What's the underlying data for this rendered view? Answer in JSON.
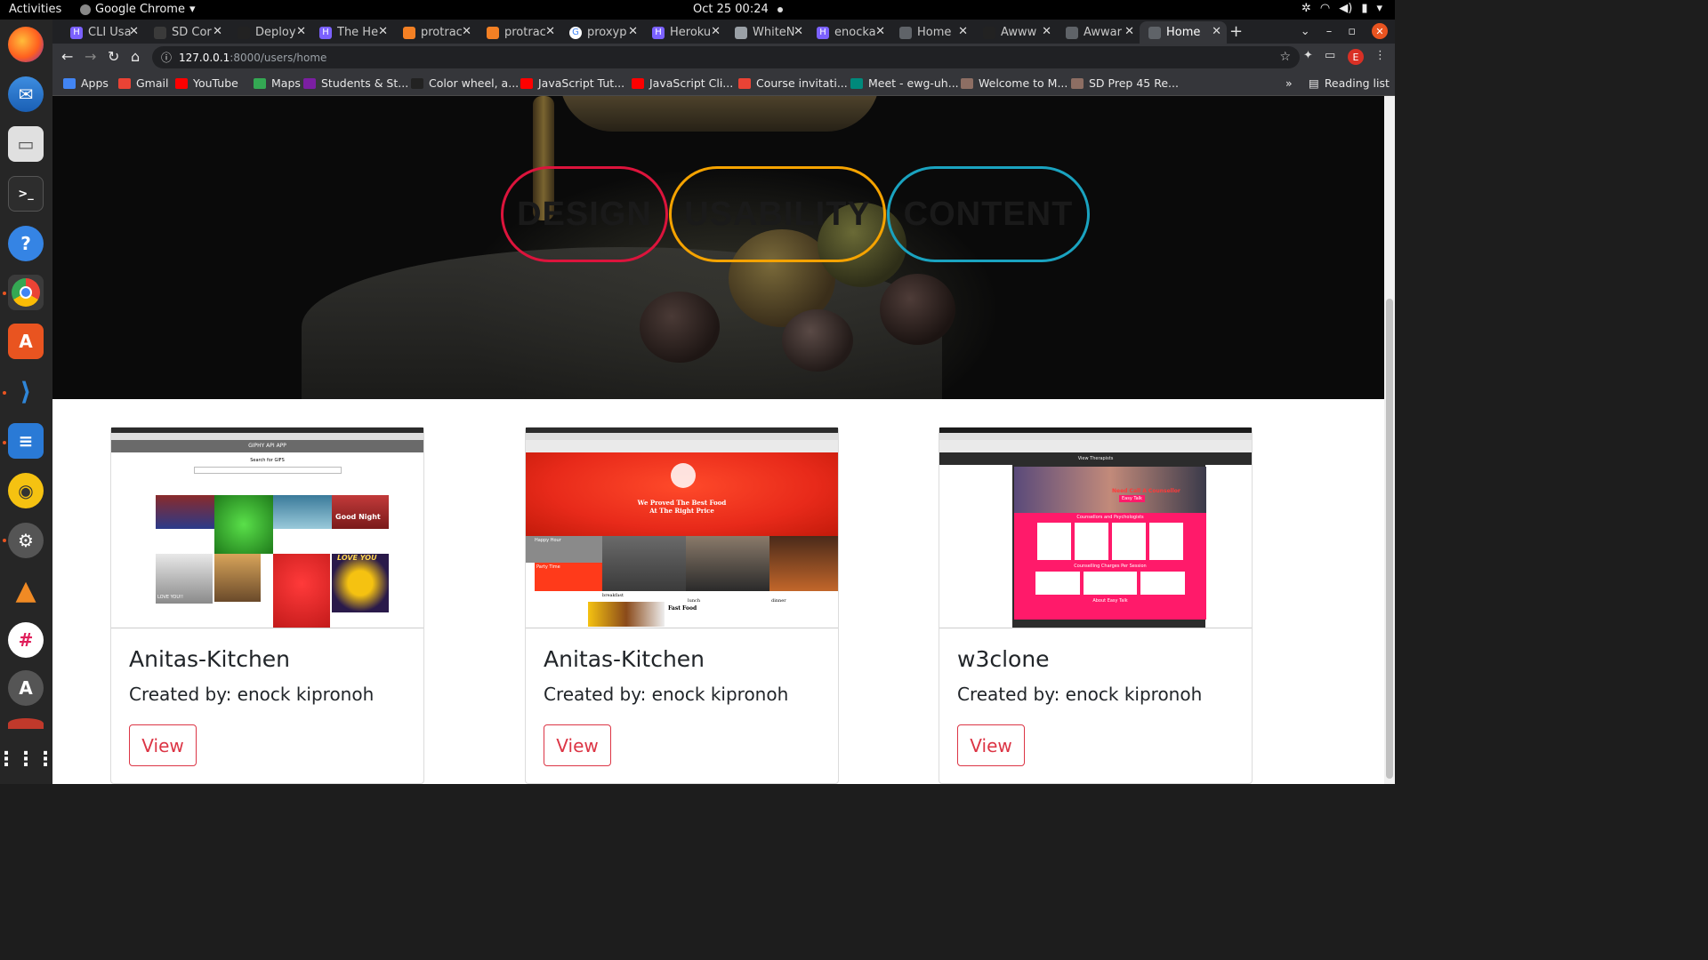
{
  "system": {
    "activities": "Activities",
    "app_name": "Google Chrome",
    "clock": "Oct 25  00:24"
  },
  "dock": [
    "firefox-icon",
    "thunderbird-icon",
    "files-icon",
    "terminal-icon",
    "help-icon",
    "chrome-icon",
    "software-center-icon",
    "vscode-icon",
    "text-editor-icon",
    "rhythmbox-icon",
    "settings-icon",
    "vlc-icon",
    "slack-icon",
    "updater-icon",
    "app-icon",
    "show-apps-icon"
  ],
  "browser": {
    "tabs": [
      {
        "title": "CLI Usa",
        "fav_color": "#7b61ff",
        "fav": "H"
      },
      {
        "title": "SD Cor",
        "fav_color": "#3a3a3a",
        "fav": ""
      },
      {
        "title": "Deploy",
        "fav_color": "#222",
        "fav": ""
      },
      {
        "title": "The He",
        "fav_color": "#7b61ff",
        "fav": "H"
      },
      {
        "title": "protrac",
        "fav_color": "#f48024",
        "fav": ""
      },
      {
        "title": "protrac",
        "fav_color": "#f48024",
        "fav": ""
      },
      {
        "title": "proxyp",
        "fav_color": "#fff",
        "fav": "G"
      },
      {
        "title": "Heroku",
        "fav_color": "#7b61ff",
        "fav": "H"
      },
      {
        "title": "WhiteN",
        "fav_color": "#9aa0a6",
        "fav": ""
      },
      {
        "title": "enocka",
        "fav_color": "#7b61ff",
        "fav": "H"
      },
      {
        "title": "Home",
        "fav_color": "#5f6368",
        "fav": ""
      },
      {
        "title": "Awww",
        "fav_color": "#222",
        "fav": ""
      },
      {
        "title": "Awwar",
        "fav_color": "#5f6368",
        "fav": ""
      },
      {
        "title": "Home",
        "fav_color": "#5f6368",
        "fav": "",
        "selected": true
      }
    ],
    "address": {
      "host": "127.0.0.1",
      "path": ":8000/users/home"
    },
    "avatar": "E",
    "bookmarks": [
      {
        "label": "Apps",
        "color": "#4285f4"
      },
      {
        "label": "Gmail",
        "color": "#ea4335"
      },
      {
        "label": "YouTube",
        "color": "#ff0000"
      },
      {
        "label": "Maps",
        "color": "#34a853"
      },
      {
        "label": "Students & St...",
        "color": "#7b1fa2"
      },
      {
        "label": "Color wheel, a...",
        "color": "#222"
      },
      {
        "label": "JavaScript Tut...",
        "color": "#ff0000"
      },
      {
        "label": "JavaScript Cli...",
        "color": "#ff0000"
      },
      {
        "label": "Course invitati...",
        "color": "#ea4335"
      },
      {
        "label": "Meet - ewg-uh...",
        "color": "#00897b"
      },
      {
        "label": "Welcome to M...",
        "color": "#8d6e63"
      },
      {
        "label": "SD Prep 45 Re...",
        "color": "#8d6e63"
      }
    ],
    "bookmarks_overflow": "»",
    "reading_list": "Reading list"
  },
  "hero": {
    "pills": [
      {
        "label": "DESIGN",
        "color": "#dc143c"
      },
      {
        "label": "USABILITY",
        "color": "#f5a300"
      },
      {
        "label": "CONTENT",
        "color": "#1aa3c0"
      }
    ]
  },
  "projects": [
    {
      "title": "Anitas-Kitchen",
      "author": "Created by: enock kipronoh",
      "button": "View",
      "thumb": "giphy"
    },
    {
      "title": "Anitas-Kitchen",
      "author": "Created by: enock kipronoh",
      "button": "View",
      "thumb": "food"
    },
    {
      "title": "w3clone",
      "author": "Created by: enock kipronoh",
      "button": "View",
      "thumb": "figma"
    }
  ],
  "thumb_text": {
    "giphy_header": "GIPHY API APP",
    "giphy_sub": "Search for GIFS",
    "gif_night": "Good Night",
    "gif_love_you": "LOVE YOU!!",
    "gif_love": "LOVE YOU",
    "food_line1": "We Proved The Best Food",
    "food_line2": "At The Right Price",
    "food_happy": "Happy Hour",
    "food_party": "Party Time",
    "food_breakfast": "breakfast",
    "food_lunch": "lunch",
    "food_dinner": "dinner",
    "food_fast": "Fast Food",
    "figma_counsel": "Counsellors and Psychologists",
    "figma_charges": "Counselling Charges Per Session",
    "figma_about": "About Easy Talk",
    "figma_view": "View Therapists",
    "figma_need": "Need Call A Counsellor",
    "figma_easy": "Easy Talk"
  }
}
